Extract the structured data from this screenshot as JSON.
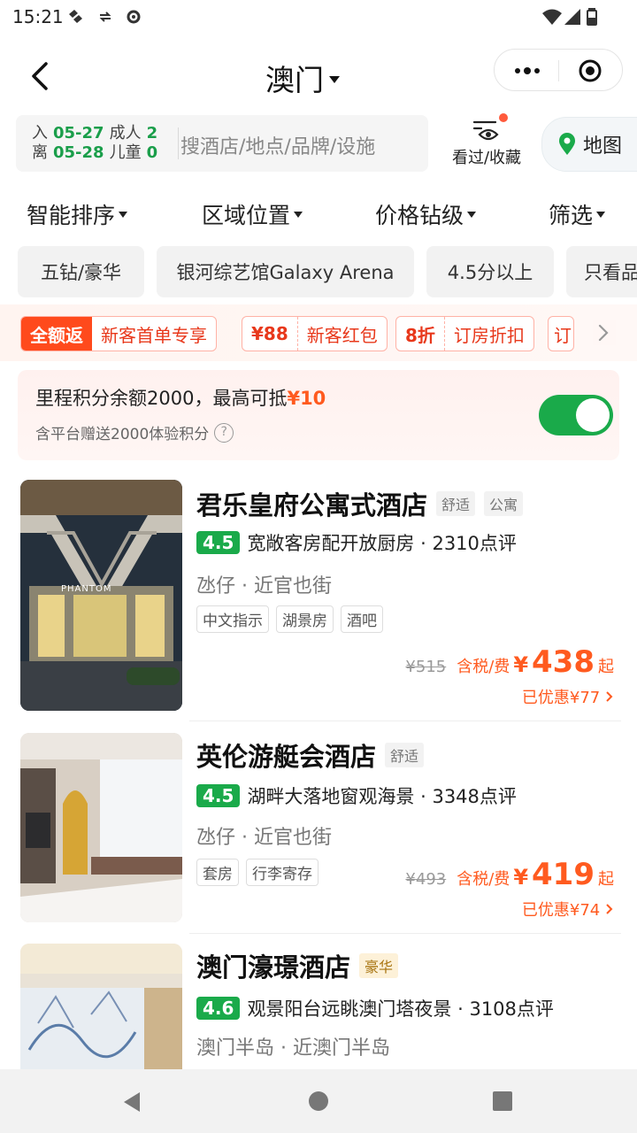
{
  "status_bar": {
    "time": "15:21",
    "icons": [
      "gesture-icon",
      "data-saver-icon",
      "settings-icon",
      "wifi-icon",
      "signal-icon",
      "battery-icon"
    ]
  },
  "header": {
    "title": "澳门",
    "back_icon": "back-arrow-icon",
    "capsule_icons": [
      "more-dots-icon",
      "record-icon"
    ]
  },
  "search": {
    "checkin_label": "入",
    "checkin_date": "05-27",
    "checkout_label": "离",
    "checkout_date": "05-28",
    "adults_label": "成人",
    "adults_count": "2",
    "children_label": "儿童",
    "children_count": "0",
    "placeholder": "搜酒店/地点/品牌/设施",
    "viewed_label": "看过/收藏",
    "map_label": "地图"
  },
  "sort_bar": [
    "智能排序",
    "区域位置",
    "价格钻级",
    "筛选"
  ],
  "filter_chips": [
    "五钻/豪华",
    "银河综艺馆Galaxy Arena",
    "4.5分以上",
    "只看品"
  ],
  "promos": [
    {
      "a": "全额返",
      "b": "新客首单专享"
    },
    {
      "a": "¥88",
      "b": "新客红包"
    },
    {
      "a": "8折",
      "b": "订房折扣"
    },
    {
      "a": "",
      "b": "订"
    }
  ],
  "points": {
    "text": "里程积分余额2000，最高可抵",
    "value": "¥10",
    "sub": "含平台赠送2000体验积分",
    "help": "?",
    "toggle_on": true
  },
  "hotels": [
    {
      "name": "君乐皇府公寓式酒店",
      "badges": [
        "舒适",
        "公寓"
      ],
      "score": "4.5",
      "highlight": "宽敞客房配开放厨房 · 2310点评",
      "location": "氹仔 · 近官也街",
      "tags": [
        "中文指示",
        "湖景房",
        "酒吧"
      ],
      "old_price": "¥515",
      "tax_label": "含税/费",
      "currency": "¥",
      "price": "438",
      "qi": "起",
      "saved": "已优惠¥77",
      "image_sign": "PHANTOM"
    },
    {
      "name": "英伦游艇会酒店",
      "badges": [
        "舒适"
      ],
      "score": "4.5",
      "highlight": "湖畔大落地窗观海景 · 3348点评",
      "location": "氹仔 · 近官也街",
      "tags": [
        "套房",
        "行李寄存"
      ],
      "old_price": "¥493",
      "tax_label": "含税/费",
      "currency": "¥",
      "price": "419",
      "qi": "起",
      "saved": "已优惠¥74"
    },
    {
      "name": "澳门濠璟酒店",
      "badges": [
        "豪华"
      ],
      "score": "4.6",
      "highlight": "观景阳台远眺澳门塔夜景 · 3108点评",
      "location": "澳门半岛 · 近澳门半岛"
    }
  ],
  "nav_bar": [
    "back-triangle-icon",
    "home-circle-icon",
    "recents-square-icon"
  ],
  "colors": {
    "accent_green": "#1aaa4a",
    "price_orange": "#ff5a1f",
    "promo_red": "#ff4a1c"
  }
}
